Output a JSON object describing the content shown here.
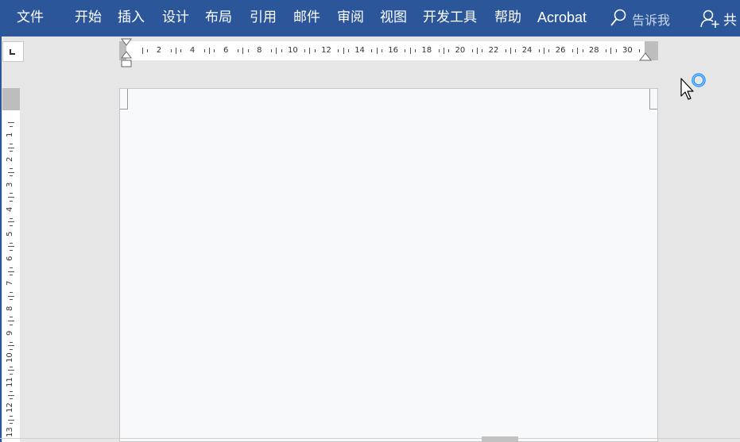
{
  "ribbon": {
    "tabs": [
      {
        "label": "文件"
      },
      {
        "label": "开始"
      },
      {
        "label": "插入"
      },
      {
        "label": "设计"
      },
      {
        "label": "布局"
      },
      {
        "label": "引用"
      },
      {
        "label": "邮件"
      },
      {
        "label": "审阅"
      },
      {
        "label": "视图"
      },
      {
        "label": "开发工具"
      },
      {
        "label": "帮助"
      },
      {
        "label": "Acrobat"
      }
    ],
    "tell_me": {
      "label": "告诉我",
      "icon": "search-icon"
    },
    "share": {
      "label": "共",
      "icon": "person-add-icon"
    }
  },
  "colors": {
    "ribbon": "#2b579a",
    "workspace": "#e6e6e6",
    "page": "#f8f9fb",
    "ruler_margin": "#bdbdbd",
    "busy_ring": "#1e90ff"
  },
  "horizontal_ruler": {
    "labels": [
      "2",
      "4",
      "6",
      "8",
      "10",
      "12",
      "14",
      "16",
      "18",
      "20",
      "22",
      "24",
      "26",
      "28",
      "30"
    ]
  },
  "vertical_ruler": {
    "labels": [
      "1",
      "2",
      "3",
      "4",
      "5",
      "6",
      "7",
      "8",
      "9",
      "10",
      "11",
      "12",
      "13"
    ]
  },
  "cursor": {
    "state": "busy"
  }
}
